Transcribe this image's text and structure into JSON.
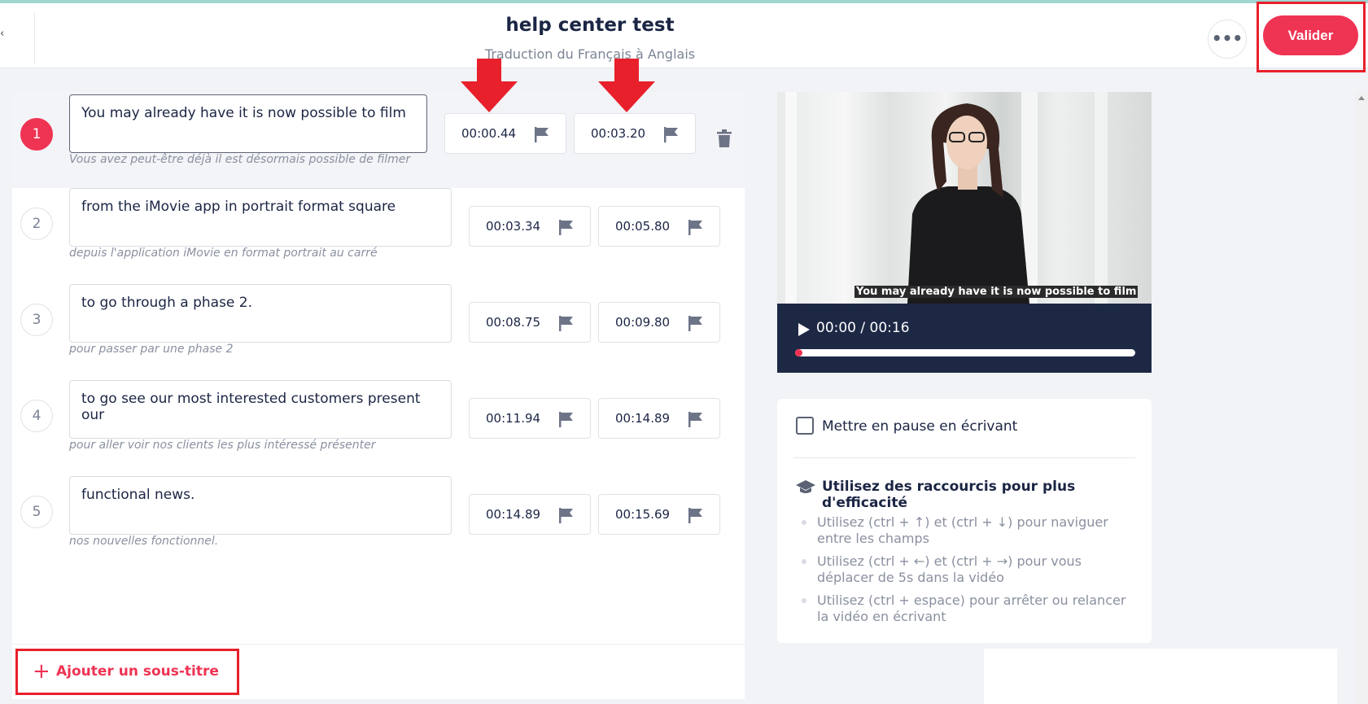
{
  "header": {
    "back_glyph": "‹",
    "title": "help center test",
    "subtitle": "Traduction du Français à Anglais",
    "more_label": "•••",
    "validate_label": "Valider"
  },
  "subtitles": [
    {
      "number": "1",
      "text": "You may already have it is now possible to film",
      "original": "Vous avez peut-être déjà il est désormais possible de filmer",
      "start": "00:00.44",
      "end": "00:03.20"
    },
    {
      "number": "2",
      "text": "from the iMovie app in portrait format square",
      "original": "depuis l'application iMovie en format portrait au carré",
      "start": "00:03.34",
      "end": "00:05.80"
    },
    {
      "number": "3",
      "text": "to go through a phase 2.",
      "original": "pour passer par une phase 2",
      "start": "00:08.75",
      "end": "00:09.80"
    },
    {
      "number": "4",
      "text": "to go see our most interested customers present our",
      "original": "pour aller voir nos clients les plus intéressé présenter",
      "start": "00:11.94",
      "end": "00:14.89"
    },
    {
      "number": "5",
      "text": "functional news.",
      "original": "nos nouvelles fonctionnel.",
      "start": "00:14.89",
      "end": "00:15.69"
    }
  ],
  "add_subtitle": {
    "plus": "+",
    "label": "Ajouter un sous-titre"
  },
  "video": {
    "caption": "You may already have it is now possible to film",
    "timecode": "00:00 / 00:16",
    "progress_fraction": 0.0
  },
  "settings": {
    "pause_label": "Mettre en pause en écrivant",
    "pause_checked": false,
    "shortcuts_title": "Utilisez des raccourcis pour plus d'efficacité",
    "tips": [
      "Utilisez (ctrl + ↑) et (ctrl + ↓) pour naviguer entre les champs",
      "Utilisez (ctrl + ←) et (ctrl + →) pour vous déplacer de 5s dans la vidéo",
      "Utilisez (ctrl + espace) pour arrêter ou relancer la vidéo en écrivant"
    ]
  },
  "colors": {
    "accent": "#ef3353",
    "highlight": "#e8202b",
    "video_bg": "#1d2845"
  },
  "icons": {
    "flag": "flag-icon",
    "trash": "trash-icon",
    "play": "play-icon",
    "hat": "graduation-cap-icon",
    "arrow": "arrow-down-icon"
  }
}
